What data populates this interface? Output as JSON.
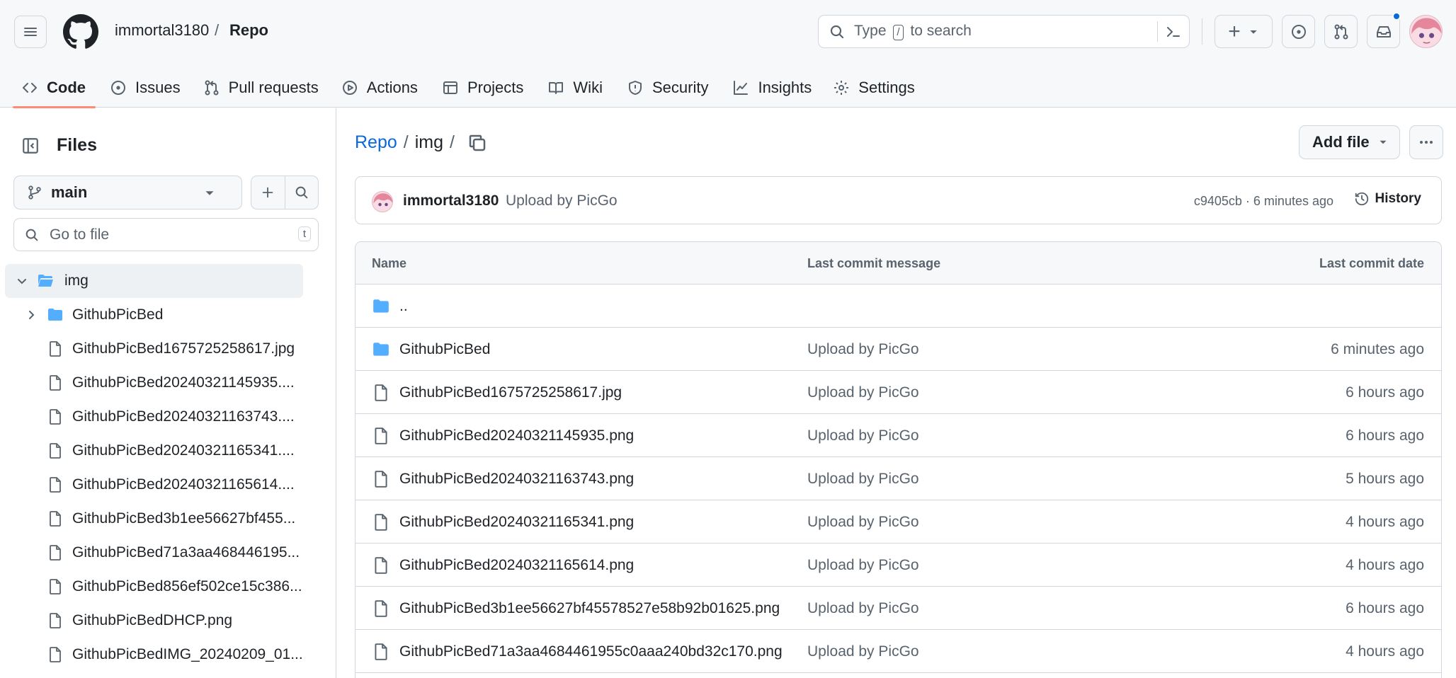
{
  "header": {
    "owner": "immortal3180",
    "separator": "/",
    "repo": "Repo",
    "search": {
      "before": "Type",
      "key": "/",
      "after": "to search"
    },
    "create_symbol": "+",
    "notification_dot_color": "#0969da"
  },
  "nav_tabs": [
    {
      "label": "Code",
      "icon": "code-icon",
      "active": true
    },
    {
      "label": "Issues",
      "icon": "issue-opened-icon"
    },
    {
      "label": "Pull requests",
      "icon": "git-pull-request-icon"
    },
    {
      "label": "Actions",
      "icon": "play-icon"
    },
    {
      "label": "Projects",
      "icon": "table-icon"
    },
    {
      "label": "Wiki",
      "icon": "book-icon"
    },
    {
      "label": "Security",
      "icon": "shield-icon"
    },
    {
      "label": "Insights",
      "icon": "graph-icon"
    },
    {
      "label": "Settings",
      "icon": "gear-icon"
    }
  ],
  "sidebar": {
    "title": "Files",
    "branch": "main",
    "goto_placeholder": "Go to file",
    "goto_shortcut": "t",
    "tree": [
      {
        "label": "img",
        "type": "folder",
        "expanded": true,
        "selected": true
      },
      {
        "label": "GithubPicBed",
        "type": "folder",
        "expanded": false
      },
      {
        "label": "GithubPicBed1675725258617.jpg",
        "type": "file"
      },
      {
        "label": "GithubPicBed20240321145935....",
        "type": "file"
      },
      {
        "label": "GithubPicBed20240321163743....",
        "type": "file"
      },
      {
        "label": "GithubPicBed20240321165341....",
        "type": "file"
      },
      {
        "label": "GithubPicBed20240321165614....",
        "type": "file"
      },
      {
        "label": "GithubPicBed3b1ee56627bf455...",
        "type": "file"
      },
      {
        "label": "GithubPicBed71a3aa468446195...",
        "type": "file"
      },
      {
        "label": "GithubPicBed856ef502ce15c386...",
        "type": "file"
      },
      {
        "label": "GithubPicBedDHCP.png",
        "type": "file"
      },
      {
        "label": "GithubPicBedIMG_20240209_01...",
        "type": "file"
      }
    ]
  },
  "main": {
    "path_root": "Repo",
    "path_sep": "/",
    "path_current": "img",
    "add_file_label": "Add file",
    "commit": {
      "author": "immortal3180",
      "message": "Upload by PicGo",
      "hash_time": "c9405cb · 6 minutes ago",
      "history_label": "History"
    },
    "table": {
      "headers": {
        "name": "Name",
        "message": "Last commit message",
        "date": "Last commit date"
      },
      "rows": [
        {
          "name": "..",
          "type": "folder",
          "message": "",
          "date": ""
        },
        {
          "name": "GithubPicBed",
          "type": "folder",
          "message": "Upload by PicGo",
          "date": "6 minutes ago"
        },
        {
          "name": "GithubPicBed1675725258617.jpg",
          "type": "file",
          "message": "Upload by PicGo",
          "date": "6 hours ago"
        },
        {
          "name": "GithubPicBed20240321145935.png",
          "type": "file",
          "message": "Upload by PicGo",
          "date": "6 hours ago"
        },
        {
          "name": "GithubPicBed20240321163743.png",
          "type": "file",
          "message": "Upload by PicGo",
          "date": "5 hours ago"
        },
        {
          "name": "GithubPicBed20240321165341.png",
          "type": "file",
          "message": "Upload by PicGo",
          "date": "4 hours ago"
        },
        {
          "name": "GithubPicBed20240321165614.png",
          "type": "file",
          "message": "Upload by PicGo",
          "date": "4 hours ago"
        },
        {
          "name": "GithubPicBed3b1ee56627bf45578527e58b92b01625.png",
          "type": "file",
          "message": "Upload by PicGo",
          "date": "6 hours ago"
        },
        {
          "name": "GithubPicBed71a3aa4684461955c0aaa240bd32c170.png",
          "type": "file",
          "message": "Upload by PicGo",
          "date": "4 hours ago"
        }
      ]
    }
  },
  "colors": {
    "accent_link": "#0969da",
    "tab_underline": "#fd8c73",
    "folder": "#54aeff",
    "muted_text": "#59636e",
    "border": "#d0d7de"
  }
}
